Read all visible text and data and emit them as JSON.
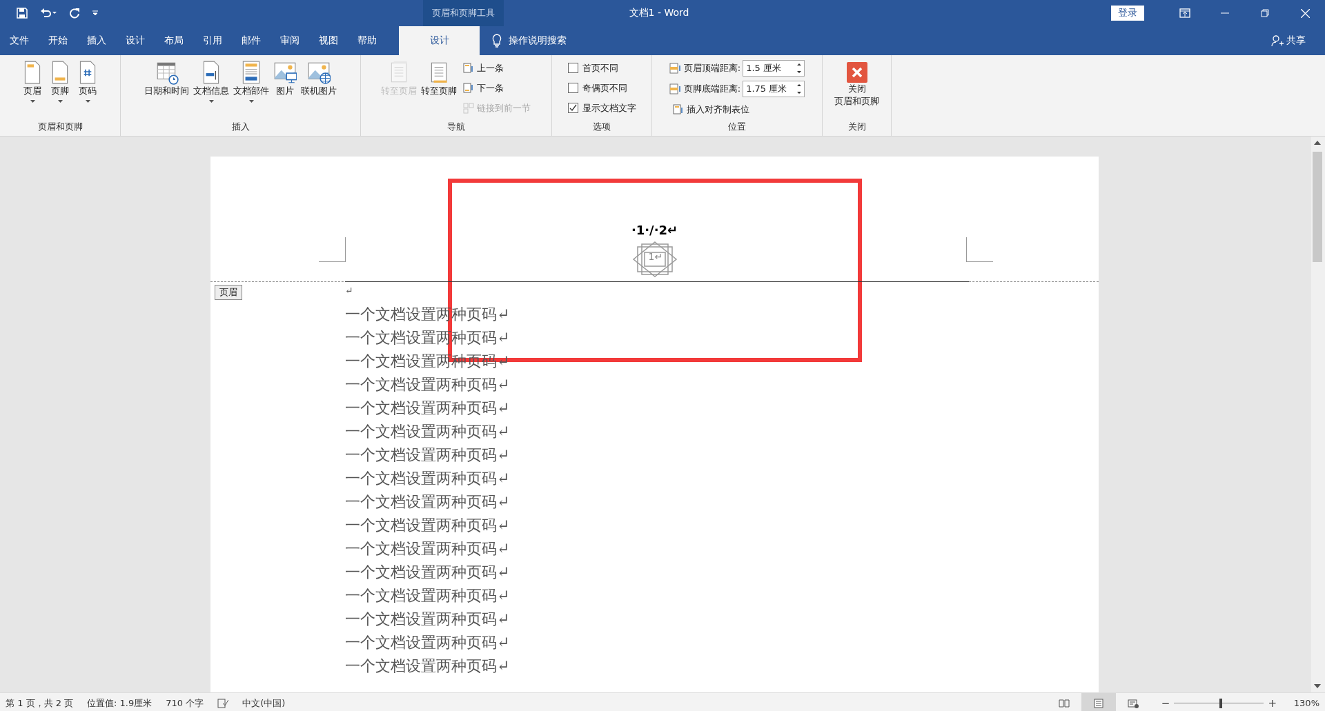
{
  "title_bar": {
    "context_tool": "页眉和页脚工具",
    "title": "文档1  -  Word",
    "login": "登录"
  },
  "menu_tabs": [
    {
      "label": "文件",
      "selected": false
    },
    {
      "label": "开始",
      "selected": false
    },
    {
      "label": "插入",
      "selected": false
    },
    {
      "label": "设计",
      "selected": false
    },
    {
      "label": "布局",
      "selected": false
    },
    {
      "label": "引用",
      "selected": false
    },
    {
      "label": "邮件",
      "selected": false
    },
    {
      "label": "审阅",
      "selected": false
    },
    {
      "label": "视图",
      "selected": false
    },
    {
      "label": "帮助",
      "selected": false
    },
    {
      "label": "设计",
      "selected": true
    }
  ],
  "tell_me": "操作说明搜索",
  "share": "共享",
  "ribbon_groups": [
    {
      "label": "页眉和页脚",
      "items": [
        {
          "kind": "large",
          "label": "页眉",
          "dropdown": true,
          "disabled": false
        },
        {
          "kind": "large",
          "label": "页脚",
          "dropdown": true,
          "disabled": false
        },
        {
          "kind": "large",
          "label": "页码",
          "dropdown": true,
          "disabled": false
        }
      ]
    },
    {
      "label": "插入",
      "items": [
        {
          "kind": "large",
          "label": "日期和时间",
          "dropdown": false,
          "disabled": false
        },
        {
          "kind": "large",
          "label": "文档信息",
          "dropdown": true,
          "disabled": false
        },
        {
          "kind": "large",
          "label": "文档部件",
          "dropdown": true,
          "disabled": false
        },
        {
          "kind": "large",
          "label": "图片",
          "dropdown": false,
          "disabled": false
        },
        {
          "kind": "large",
          "label": "联机图片",
          "dropdown": false,
          "disabled": false
        }
      ]
    },
    {
      "label": "导航",
      "items": [
        {
          "kind": "large",
          "label": "转至页眉",
          "dropdown": false,
          "disabled": true
        },
        {
          "kind": "large",
          "label": "转至页脚",
          "dropdown": false,
          "disabled": false
        },
        {
          "kind": "column",
          "items": [
            {
              "kind": "small",
              "label": "上一条",
              "disabled": false
            },
            {
              "kind": "small",
              "label": "下一条",
              "disabled": false
            },
            {
              "kind": "small",
              "label": "链接到前一节",
              "disabled": true
            }
          ]
        }
      ]
    },
    {
      "label": "选项",
      "items": [
        {
          "kind": "column",
          "items": [
            {
              "kind": "checkbox",
              "label": "首页不同",
              "checked": false
            },
            {
              "kind": "checkbox",
              "label": "奇偶页不同",
              "checked": false
            },
            {
              "kind": "checkbox",
              "label": "显示文档文字",
              "checked": true
            }
          ]
        }
      ]
    },
    {
      "label": "位置",
      "items": [
        {
          "kind": "column",
          "items": [
            {
              "kind": "spin",
              "label": "页眉顶端距离:",
              "value": "1.5 厘米"
            },
            {
              "kind": "spin",
              "label": "页脚底端距离:",
              "value": "1.75 厘米"
            },
            {
              "kind": "small",
              "label": "插入对齐制表位",
              "disabled": false
            }
          ]
        }
      ]
    },
    {
      "label": "关闭",
      "items": [
        {
          "kind": "close",
          "label_lines": [
            "关闭",
            "页眉和页脚"
          ]
        }
      ]
    }
  ],
  "document": {
    "header_text": "·1·/·2↵",
    "header_shape_text": "1↵",
    "header_tag": "页眉",
    "empty_paragraph": "↵",
    "lines": [
      "一个文档设置两种页码↵",
      "一个文档设置两种页码↵",
      "一个文档设置两种页码↵",
      "一个文档设置两种页码↵",
      "一个文档设置两种页码↵",
      "一个文档设置两种页码↵",
      "一个文档设置两种页码↵",
      "一个文档设置两种页码↵",
      "一个文档设置两种页码↵",
      "一个文档设置两种页码↵",
      "一个文档设置两种页码↵",
      "一个文档设置两种页码↵",
      "一个文档设置两种页码↵",
      "一个文档设置两种页码↵",
      "一个文档设置两种页码↵",
      "一个文档设置两种页码↵"
    ]
  },
  "status_bar": {
    "page": "第 1 页，共 2 页",
    "position": "位置值: 1.9厘米",
    "words": "710 个字",
    "language": "中文(中国)",
    "view_modes": [
      {
        "selected": false
      },
      {
        "selected": true
      },
      {
        "selected": false
      }
    ],
    "zoom_minus": "−",
    "zoom_plus": "+",
    "zoom": {
      "level": 0.52
    },
    "zoom_value": "130%"
  }
}
